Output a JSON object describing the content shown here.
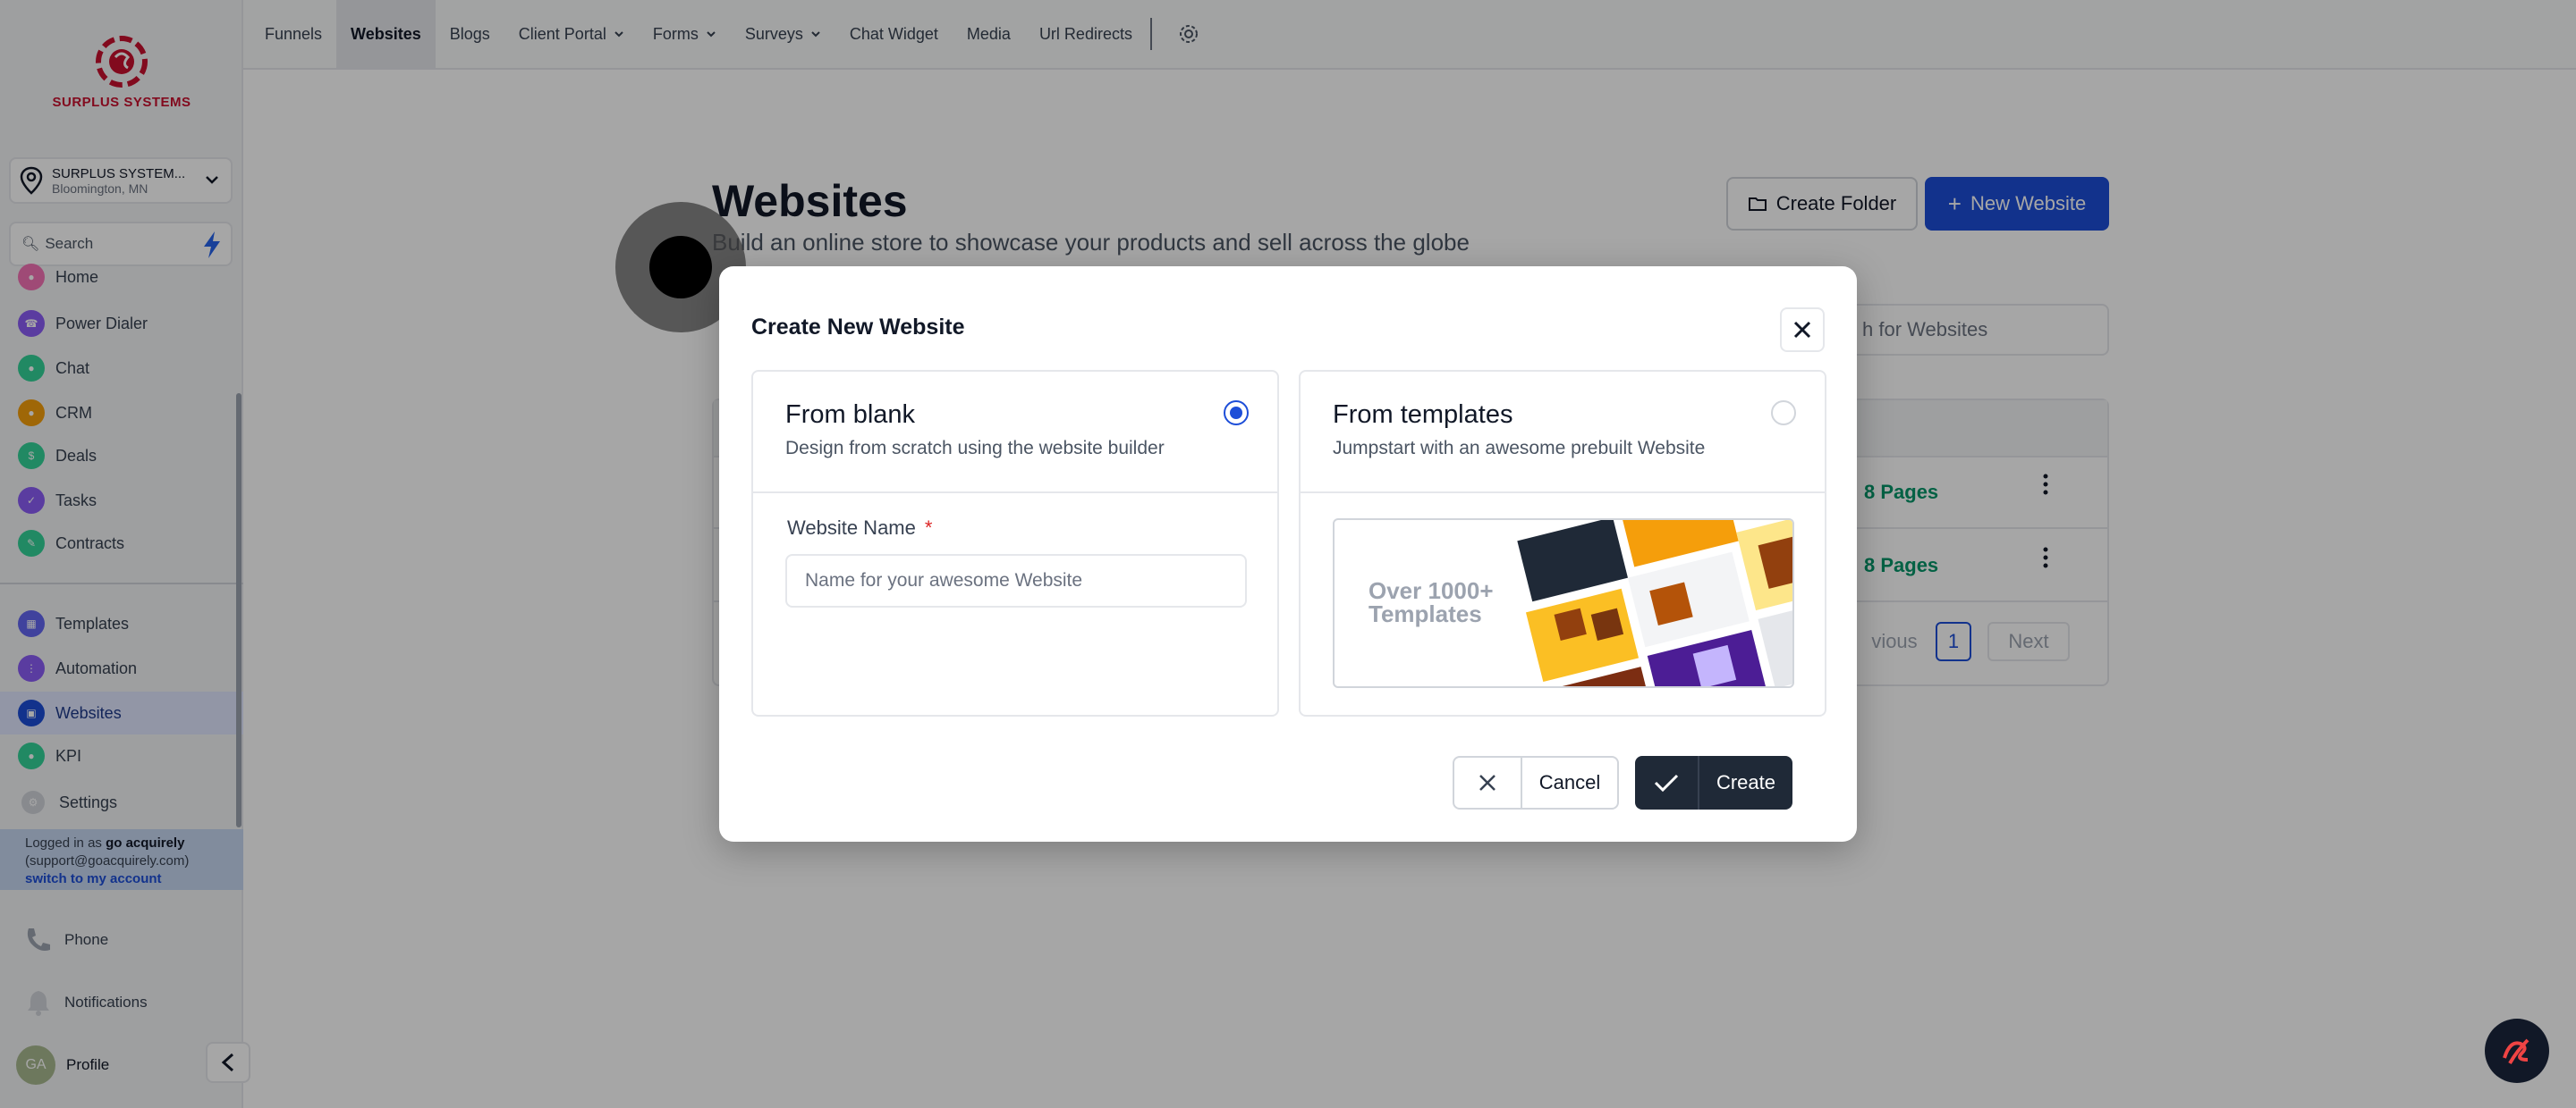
{
  "brand": {
    "logo_text": "SURPLUS SYSTEMS"
  },
  "location": {
    "name": "SURPLUS SYSTEM...",
    "city": "Bloomington, MN"
  },
  "sidebar": {
    "search_label": "Search",
    "items": [
      {
        "label": "Home",
        "color": "#f472b6"
      },
      {
        "label": "Power Dialer",
        "color": "#8b5cf6"
      },
      {
        "label": "Chat",
        "color": "#34d399"
      },
      {
        "label": "CRM",
        "color": "#f59e0b"
      },
      {
        "label": "Deals",
        "color": "#34d399"
      },
      {
        "label": "Tasks",
        "color": "#8b5cf6"
      },
      {
        "label": "Contracts",
        "color": "#34d399"
      },
      {
        "label": "Templates",
        "color": "#6366f1"
      },
      {
        "label": "Automation",
        "color": "#8b5cf6"
      },
      {
        "label": "Websites",
        "color": "#1d4ed8"
      },
      {
        "label": "KPI",
        "color": "#34d399"
      },
      {
        "label": "Settings",
        "color": "#9ca3af"
      }
    ],
    "login": {
      "prefix": "Logged in as",
      "user": "go acquirely",
      "email": "(support@goacquirely.com)",
      "switch": "switch to my account"
    },
    "phone": "Phone",
    "notifications": "Notifications",
    "profile": {
      "initials": "GA",
      "label": "Profile"
    }
  },
  "topbar": {
    "tabs": [
      "Funnels",
      "Websites",
      "Blogs",
      "Client Portal",
      "Forms",
      "Surveys",
      "Chat Widget",
      "Media",
      "Url Redirects"
    ],
    "active_tab": "Websites"
  },
  "page": {
    "title": "Websites",
    "subtitle": "Build an online store to showcase your products and sell across the globe",
    "create_folder": "Create Folder",
    "new_website": "New Website",
    "search_placeholder": "Search for Websites",
    "search_visible": "h for Websites",
    "rows": [
      {
        "pages": "8 Pages"
      },
      {
        "pages": "8 Pages"
      }
    ],
    "pagination": {
      "previous": "vious",
      "current": "1",
      "next": "Next"
    }
  },
  "modal": {
    "title": "Create New Website",
    "blank": {
      "title": "From blank",
      "description": "Design from scratch using the website builder",
      "selected": true
    },
    "templates": {
      "title": "From templates",
      "description": "Jumpstart with an awesome prebuilt Website",
      "selected": false,
      "preview_line1": "Over 1000+",
      "preview_line2": "Templates"
    },
    "field": {
      "label": "Website Name",
      "required_mark": "*",
      "placeholder": "Name for your awesome Website",
      "value": ""
    },
    "cancel": "Cancel",
    "create": "Create"
  },
  "colors": {
    "accent": "#1d4ed8",
    "brand_red": "#c8102e",
    "success": "#059669",
    "dark": "#1f2937"
  }
}
